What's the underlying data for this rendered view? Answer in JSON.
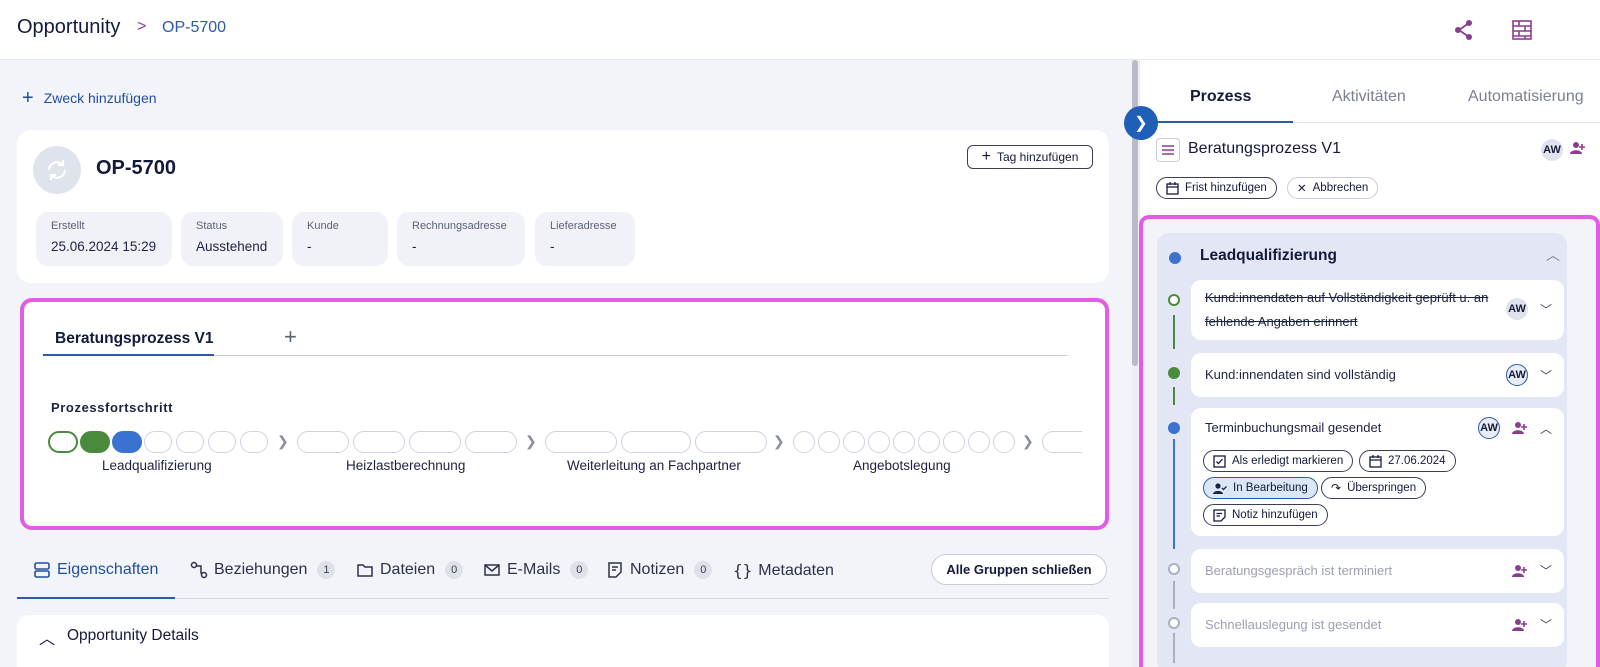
{
  "header": {
    "breadcrumb_root": "Opportunity",
    "breadcrumb_sep": ">",
    "breadcrumb_current": "OP-5700"
  },
  "left": {
    "add_purpose": "Zweck hinzufügen",
    "title": "OP-5700",
    "tag_button": "Tag hinzufügen",
    "info": [
      {
        "key": "Erstellt",
        "value": "25.06.2024 15:29"
      },
      {
        "key": "Status",
        "value": "Ausstehend"
      },
      {
        "key": "Kunde",
        "value": "-"
      },
      {
        "key": "Rechnungsadresse",
        "value": "-"
      },
      {
        "key": "Lieferadresse",
        "value": "-"
      }
    ],
    "process_tab": "Beratungsprozess V1",
    "progress_label": "Prozessfortschritt",
    "stages": [
      "Leadqualifizierung",
      "Heizlastberechnung",
      "Weiterleitung an Fachpartner",
      "Angebotslegung"
    ],
    "tabs": [
      {
        "label": "Eigenschaften",
        "count": ""
      },
      {
        "label": "Beziehungen",
        "count": "1"
      },
      {
        "label": "Dateien",
        "count": "0"
      },
      {
        "label": "E-Mails",
        "count": "0"
      },
      {
        "label": "Notizen",
        "count": "0"
      },
      {
        "label": "Metadaten",
        "count": ""
      }
    ],
    "close_groups": "Alle Gruppen schließen",
    "details_title": "Opportunity Details"
  },
  "right": {
    "tabs": [
      "Prozess",
      "Aktivitäten",
      "Automatisierung"
    ],
    "flow_name": "Beratungsprozess V1",
    "assignee": "AW",
    "add_deadline": "Frist hinzufügen",
    "cancel": "Abbrechen",
    "stage_title": "Leadqualifizierung",
    "steps": [
      {
        "text": "Kund:innendaten auf Vollständigkeit geprüft u. an fehlende Angaben erinnert",
        "assignee": "AW"
      },
      {
        "text": "Kund:innendaten sind vollständig",
        "assignee": "AW"
      },
      {
        "text": "Terminbuchungsmail gesendet",
        "assignee": "AW"
      },
      {
        "text": "Beratungsgespräch ist terminiert",
        "assignee": ""
      },
      {
        "text": "Schnellauslegung ist gesendet",
        "assignee": ""
      }
    ],
    "actions": {
      "mark_done": "Als erledigt markieren",
      "date": "27.06.2024",
      "in_progress": "In Bearbeitung",
      "skip": "Überspringen",
      "add_note": "Notiz hinzufügen"
    }
  },
  "colors": {
    "brand_blue": "#2a5aa8",
    "highlight": "#e25ce6",
    "done_green": "#4a8a3c",
    "current_blue": "#3a72d0",
    "accent_purple": "#8a3d8f"
  }
}
